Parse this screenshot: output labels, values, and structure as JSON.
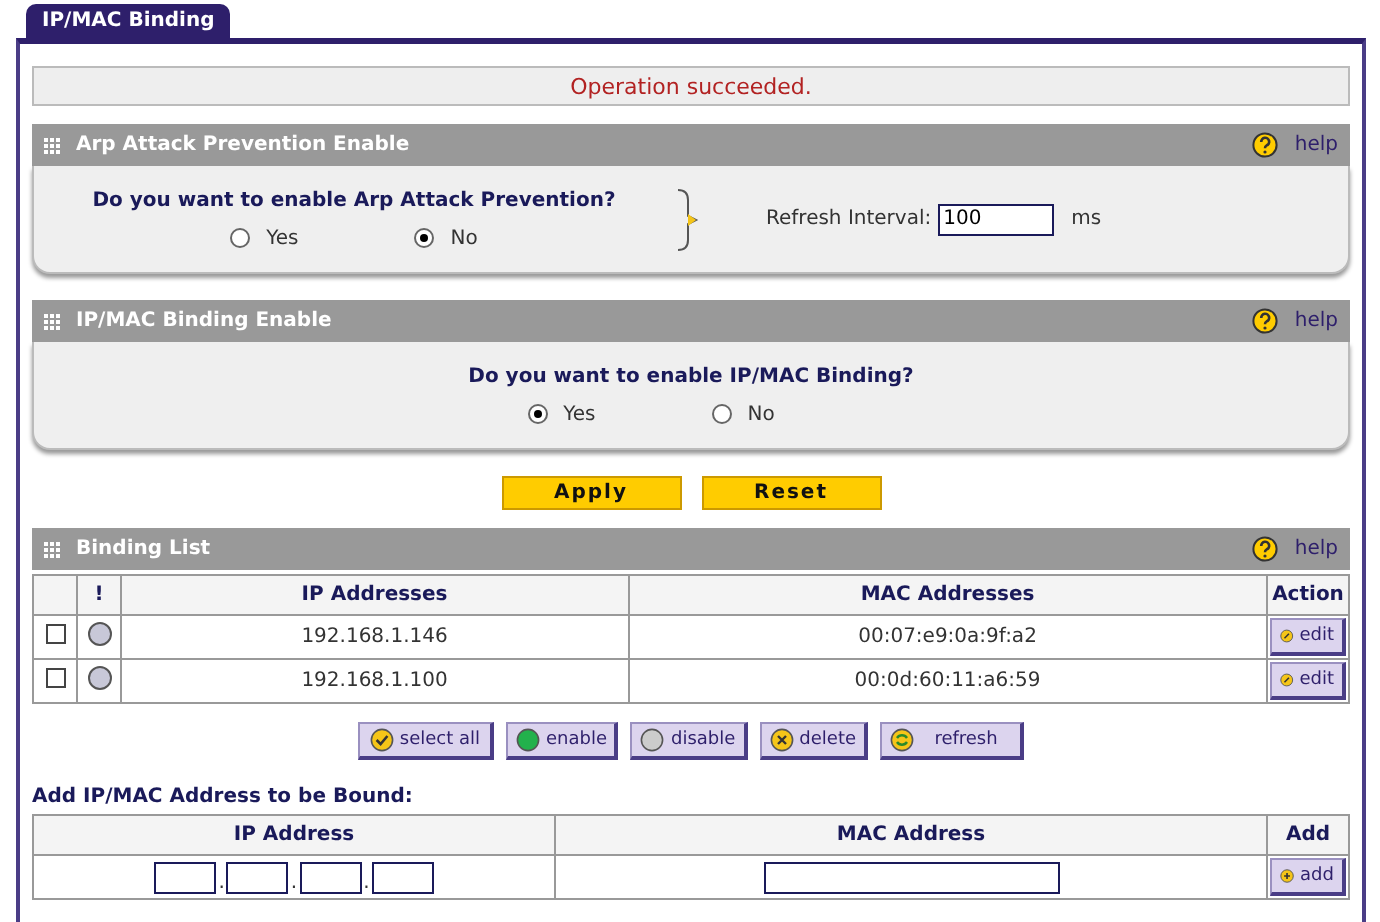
{
  "tab": {
    "label": "IP/MAC Binding",
    "selected": true
  },
  "status_message": "Operation succeeded.",
  "arp_section": {
    "title": "Arp Attack Prevention Enable",
    "help": "help",
    "question": "Do you want to enable Arp Attack Prevention?",
    "options": [
      {
        "label": "Yes",
        "selected": false
      },
      {
        "label": "No",
        "selected": true
      }
    ],
    "refresh_label": "Refresh Interval:",
    "refresh_value": "100",
    "refresh_unit": "ms"
  },
  "binding_section": {
    "title": "IP/MAC Binding Enable",
    "help": "help",
    "question": "Do you want to enable IP/MAC Binding?",
    "options": [
      {
        "label": "Yes",
        "selected": true
      },
      {
        "label": "No",
        "selected": false
      }
    ]
  },
  "buttons": [
    "Apply",
    "Reset"
  ],
  "binding_list": {
    "title": "Binding List",
    "help": "help",
    "columns": [
      "!",
      "IP Addresses",
      "MAC Addresses",
      "Action"
    ],
    "rows": [
      {
        "checked": false,
        "ip": "192.168.1.146",
        "mac": "00:07:e9:0a:9f:a2",
        "action": "edit"
      },
      {
        "checked": false,
        "ip": "192.168.1.100",
        "mac": "00:0d:60:11:a6:59",
        "action": "edit"
      }
    ],
    "actions": [
      {
        "kind": "select",
        "label": "select all"
      },
      {
        "kind": "enable",
        "label": "enable"
      },
      {
        "kind": "disable",
        "label": "disable"
      },
      {
        "kind": "delete",
        "label": "delete"
      },
      {
        "kind": "refresh",
        "label": "refresh"
      }
    ]
  },
  "add_section": {
    "title": "Add IP/MAC Address to be Bound:",
    "columns": [
      "IP Address",
      "MAC Address",
      "Add"
    ],
    "add_button": "add",
    "ip_separators": [
      ".",
      ".",
      "."
    ]
  }
}
